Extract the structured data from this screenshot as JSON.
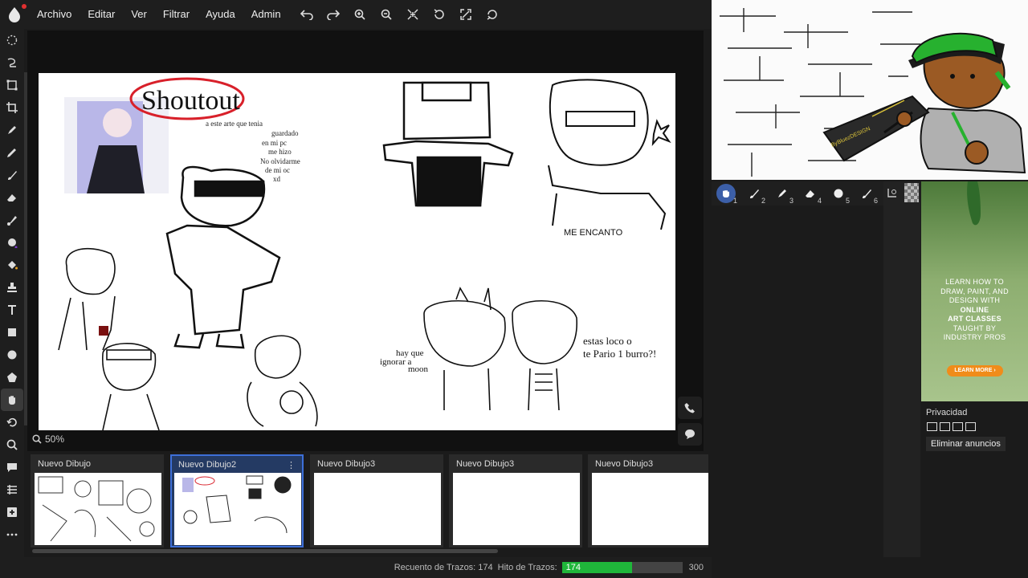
{
  "menu": [
    "Archivo",
    "Editar",
    "Ver",
    "Filtrar",
    "Ayuda",
    "Admin"
  ],
  "toolbar_icons": [
    "undo-icon",
    "redo-icon",
    "zoom-in-icon",
    "zoom-out-icon",
    "fit-icon",
    "rotate-icon",
    "fullscreen-icon",
    "flip-icon"
  ],
  "tools": [
    "lasso-select",
    "free-transform",
    "select",
    "crop",
    "pen",
    "pencil",
    "brush",
    "eraser",
    "smudge",
    "blur",
    "fill",
    "stamp",
    "text",
    "rectangle",
    "ellipse",
    "shape",
    "hand",
    "history",
    "zoom",
    "chat",
    "library",
    "add",
    "more"
  ],
  "zoom_level": "50%",
  "canvas": {
    "texts": {
      "shoutout": "Shoutout",
      "note1": "a este arte que tenia",
      "note2": "guardado",
      "note3": "en mi pc",
      "note4": "me hizo",
      "note5": "No olvidarme",
      "note6": "de mi oc",
      "note7": "xd",
      "me_encanto": "ME ENCANTO",
      "hay_que": "hay que",
      "ignorar": "ignorar a",
      "moon": "moon",
      "estas": "estas loco o",
      "pario": "te Pario 1 burro?!"
    }
  },
  "thumbnails": [
    {
      "label": "Nuevo Dibujo",
      "selected": false
    },
    {
      "label": "Nuevo Dibujo2",
      "selected": true
    },
    {
      "label": "Nuevo Dibujo3",
      "selected": false
    },
    {
      "label": "Nuevo Dibujo3",
      "selected": false
    },
    {
      "label": "Nuevo Dibujo3",
      "selected": false
    }
  ],
  "status": {
    "stroke_count_label": "Recuento de Trazos: 174",
    "stroke_goal_label": "Hito de Trazos:",
    "current": "174",
    "goal": "300",
    "progress": 0.58
  },
  "video": {
    "badge_text": "ByBluezDESIGN"
  },
  "brushes": [
    {
      "icon": "hand-icon",
      "num": "1",
      "active": true
    },
    {
      "icon": "brush-icon",
      "num": "2",
      "active": false
    },
    {
      "icon": "pen-icon",
      "num": "3",
      "active": false
    },
    {
      "icon": "eraser-icon",
      "num": "4",
      "active": false
    },
    {
      "icon": "circle-brush-icon",
      "num": "5",
      "active": false
    },
    {
      "icon": "paint-brush-icon",
      "num": "6",
      "active": false
    }
  ],
  "ad": {
    "line1": "LEARN HOW TO",
    "line2": "DRAW, PAINT, AND",
    "line3": "DESIGN WITH",
    "line4": "ONLINE",
    "line5": "ART CLASSES",
    "line6": "TAUGHT BY",
    "line7": "INDUSTRY PROS",
    "button": "LEARN MORE ›"
  },
  "privacy_label": "Privacidad",
  "remove_ads_label": "Eliminar anuncios"
}
